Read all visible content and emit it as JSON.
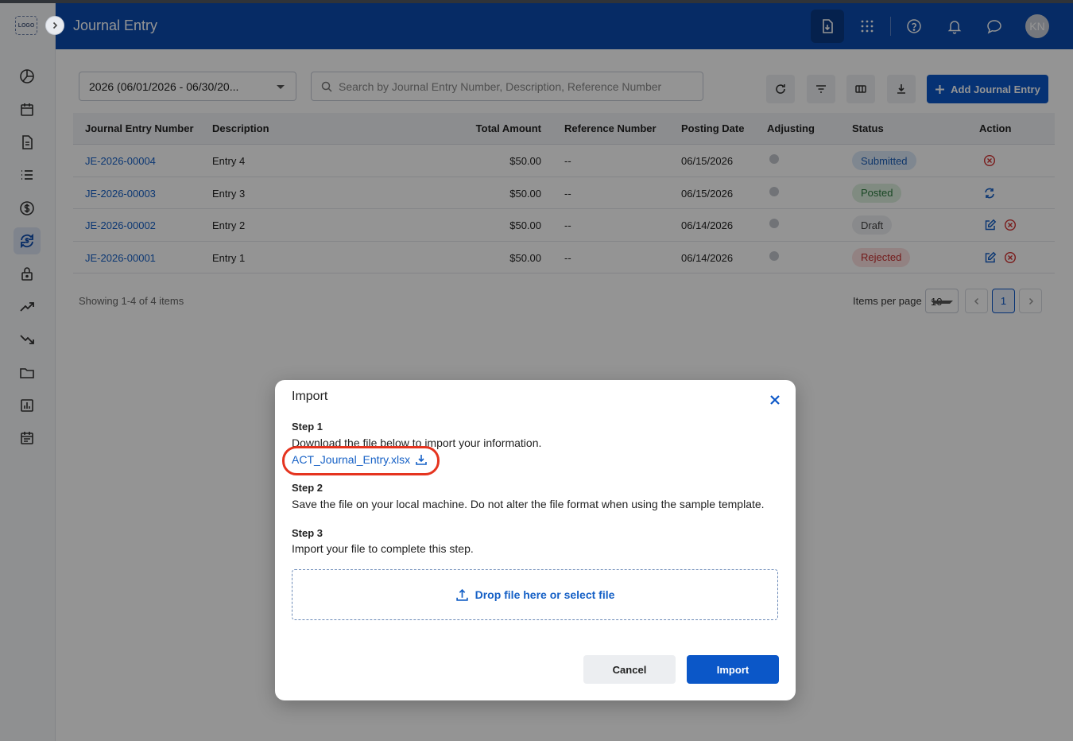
{
  "app": {
    "logo_text": "LOGO",
    "title": "Journal Entry",
    "avatar_initials": "KN"
  },
  "colors": {
    "header": "#0b4bae",
    "primary": "#0b57c8",
    "link": "#1560c6",
    "highlight": "#e5341f"
  },
  "sidebar": {
    "items": [
      {
        "icon": "pie-chart-icon"
      },
      {
        "icon": "calendar-icon"
      },
      {
        "icon": "document-icon"
      },
      {
        "icon": "list-icon"
      },
      {
        "icon": "dollar-icon"
      },
      {
        "icon": "currency-exchange-icon",
        "active": true
      },
      {
        "icon": "lock-icon"
      },
      {
        "icon": "trending-up-icon"
      },
      {
        "icon": "trending-down-icon"
      },
      {
        "icon": "folder-icon"
      },
      {
        "icon": "report-icon"
      },
      {
        "icon": "schedule-icon"
      }
    ]
  },
  "header_icons": [
    "import-icon",
    "apps-grid-icon",
    "help-icon",
    "bell-icon",
    "chat-icon"
  ],
  "toolbar": {
    "period_value": "2026 (06/01/2026 - 06/30/20...",
    "search_placeholder": "Search by Journal Entry Number, Description, Reference Number",
    "add_label": "Add Journal Entry"
  },
  "table": {
    "headers": {
      "number": "Journal Entry Number",
      "description": "Description",
      "amount": "Total Amount",
      "reference": "Reference Number",
      "posting": "Posting Date",
      "adjusting": "Adjusting",
      "status": "Status",
      "action": "Action"
    },
    "rows": [
      {
        "number": "JE-2026-00004",
        "description": "Entry 4",
        "amount": "$50.00",
        "reference": "--",
        "posting": "06/15/2026",
        "status": "Submitted"
      },
      {
        "number": "JE-2026-00003",
        "description": "Entry 3",
        "amount": "$50.00",
        "reference": "--",
        "posting": "06/15/2026",
        "status": "Posted"
      },
      {
        "number": "JE-2026-00002",
        "description": "Entry 2",
        "amount": "$50.00",
        "reference": "--",
        "posting": "06/14/2026",
        "status": "Draft"
      },
      {
        "number": "JE-2026-00001",
        "description": "Entry 1",
        "amount": "$50.00",
        "reference": "--",
        "posting": "06/14/2026",
        "status": "Rejected"
      }
    ]
  },
  "pagination": {
    "showing": "Showing 1-4 of 4 items",
    "items_per_page_label": "Items per page",
    "items_per_page": "10",
    "current_page": "1"
  },
  "modal": {
    "title": "Import",
    "step1_heading": "Step 1",
    "step1_text": "Download the file below to import your information.",
    "file_name": "ACT_Journal_Entry.xlsx",
    "step2_heading": "Step 2",
    "step2_text": "Save the file on your local machine. Do not alter the file format when using the sample template.",
    "step3_heading": "Step 3",
    "step3_text": "Import your file to complete this step.",
    "dropzone_text": "Drop file here or select file",
    "cancel_label": "Cancel",
    "import_label": "Import"
  }
}
